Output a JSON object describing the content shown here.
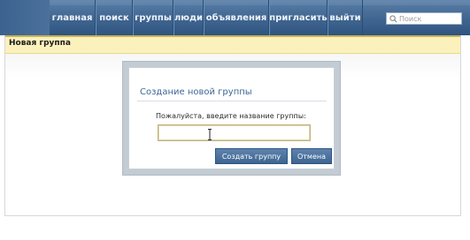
{
  "nav": {
    "items": [
      {
        "label": "главная"
      },
      {
        "label": "поиск"
      },
      {
        "label": "группы"
      },
      {
        "label": "люди"
      },
      {
        "label": "объявления"
      },
      {
        "label": "пригласить"
      },
      {
        "label": "выйти"
      }
    ]
  },
  "search": {
    "placeholder": "Поиск",
    "value": ""
  },
  "page": {
    "title": "Новая группа"
  },
  "dialog": {
    "title": "Создание новой группы",
    "prompt": "Пожалуйста, введите название группы:",
    "input_value": "",
    "create_label": "Создать группу",
    "cancel_label": "Отмена"
  },
  "colors": {
    "topbar": "#3f6590",
    "page_header": "#fbf1bc",
    "accent_text": "#3d6796",
    "button": "#4a6f99"
  }
}
